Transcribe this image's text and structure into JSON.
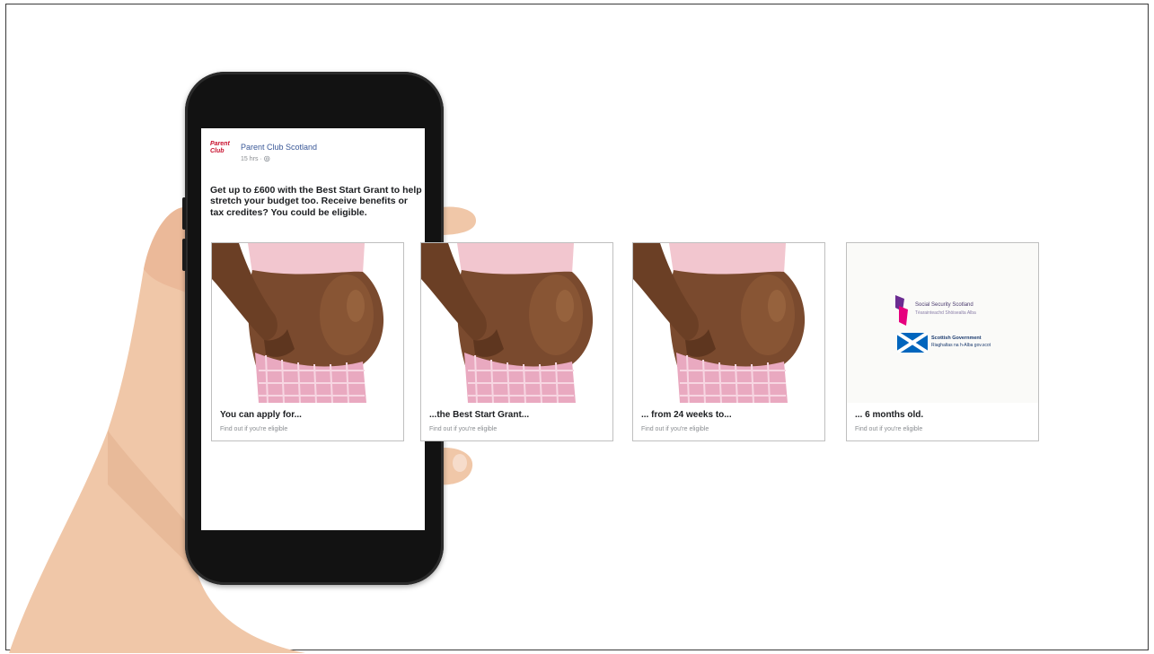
{
  "post": {
    "avatar_text": "Parent Club",
    "page_name": "Parent Club Scotland",
    "meta": "15 hrs · ",
    "text": "Get up to £600 with the Best Start Grant to help stretch your budget too. Receive benefits or tax credites? You could be eligible."
  },
  "cards": [
    {
      "title": "You can apply for...",
      "subtitle": "Find out if you're eligible"
    },
    {
      "title": "...the Best Start Grant...",
      "subtitle": "Find out if you're eligible"
    },
    {
      "title": "... from 24 weeks to...",
      "subtitle": "Find out if you're eligible"
    },
    {
      "title": "... 6 months old.",
      "subtitle": "Find out if you're eligible"
    }
  ],
  "logos": {
    "social_security_name": "Social Security Scotland",
    "social_security_gaelic": "Tèarainteachd Shòisealta Alba",
    "scot_gov_name": "Scottish Government",
    "scot_gov_gaelic": "Riaghaltas na h-Alba gov.scot"
  },
  "colors": {
    "page_name": "#3b5998",
    "brand_red": "#c8102e",
    "skin": "#7a4a2e",
    "top_pink": "#f2c6cf",
    "pants_pink": "#e9a9c0"
  }
}
